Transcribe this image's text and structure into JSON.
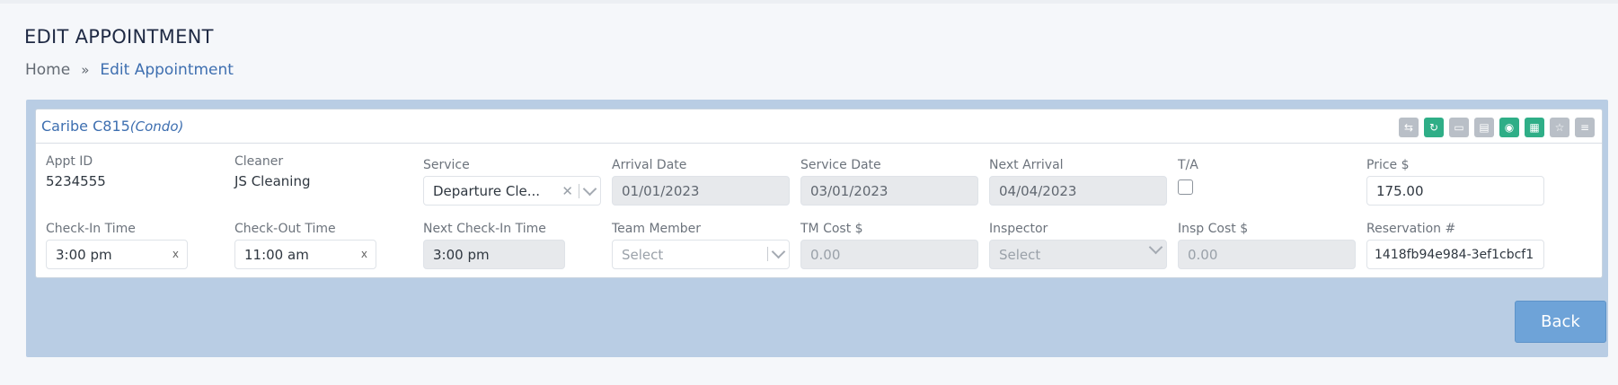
{
  "header": {
    "title": "EDIT APPOINTMENT",
    "breadcrumb": {
      "home": "Home",
      "separator": "»",
      "current": "Edit Appointment"
    }
  },
  "card": {
    "title": "Caribe C815",
    "subtitle": "(Condo)",
    "toolbar_icons": [
      "swap-icon",
      "refresh-icon",
      "folder-icon",
      "document-icon",
      "camera-icon",
      "file-icon",
      "star-icon",
      "list-icon"
    ],
    "toolbar_glyphs": [
      "⇆",
      "↻",
      "▭",
      "▤",
      "◉",
      "▦",
      "☆",
      "≡"
    ]
  },
  "fields": {
    "appt_id": {
      "label": "Appt ID",
      "value": "5234555"
    },
    "cleaner": {
      "label": "Cleaner",
      "value": "JS Cleaning"
    },
    "service": {
      "label": "Service",
      "value": "Departure Cle..."
    },
    "arrival_date": {
      "label": "Arrival Date",
      "value": "01/01/2023"
    },
    "service_date": {
      "label": "Service Date",
      "value": "03/01/2023"
    },
    "next_arrival": {
      "label": "Next Arrival",
      "value": "04/04/2023"
    },
    "ta": {
      "label": "T/A",
      "checked": false
    },
    "price": {
      "label": "Price $",
      "value": "175.00"
    },
    "checkin_time": {
      "label": "Check-In Time",
      "value": "3:00 pm",
      "clear": "x"
    },
    "checkout_time": {
      "label": "Check-Out Time",
      "value": "11:00 am",
      "clear": "x"
    },
    "next_checkin_time": {
      "label": "Next Check-In Time",
      "value": "3:00 pm"
    },
    "team_member": {
      "label": "Team Member",
      "placeholder": "Select"
    },
    "tm_cost": {
      "label": "TM Cost $",
      "placeholder": "0.00"
    },
    "inspector": {
      "label": "Inspector",
      "placeholder": "Select"
    },
    "insp_cost": {
      "label": "Insp Cost $",
      "placeholder": "0.00"
    },
    "reservation": {
      "label": "Reservation #",
      "value": "1418fb94e984-3ef1cbcf1"
    }
  },
  "buttons": {
    "back": "Back",
    "clear_glyph": "✕"
  },
  "colors": {
    "accent": "#3e6fb0",
    "panel": "#b9cde4",
    "green_tool": "#2fae87",
    "back_button": "#6ea3d8"
  }
}
